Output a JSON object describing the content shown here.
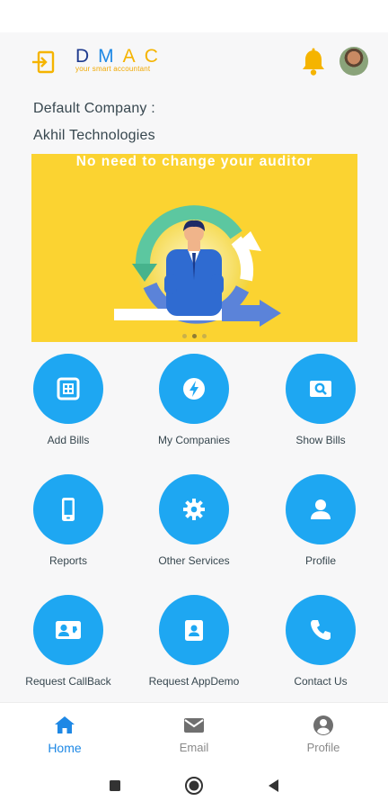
{
  "header": {
    "login_icon": "login-arrow-icon",
    "logo_letters": [
      "D",
      "M",
      "A",
      "C"
    ],
    "logo_tagline": "your smart accountant",
    "bell_icon": "bell-icon",
    "avatar_icon": "user-avatar"
  },
  "company": {
    "label": "Default Company :",
    "name": "Akhil Technologies"
  },
  "banner": {
    "text": "No need to change your auditor",
    "slides": 3,
    "active_slide": 2
  },
  "tiles": [
    {
      "label": "Add Bills",
      "icon": "add-bill-icon"
    },
    {
      "label": "My Companies",
      "icon": "lightning-icon"
    },
    {
      "label": "Show Bills",
      "icon": "search-image-icon"
    },
    {
      "label": "Reports",
      "icon": "phone-device-icon"
    },
    {
      "label": "Other Services",
      "icon": "gear-icon"
    },
    {
      "label": "Profile",
      "icon": "person-icon"
    },
    {
      "label": "Request CallBack",
      "icon": "contact-card-icon"
    },
    {
      "label": "Request AppDemo",
      "icon": "contact-badge-icon"
    },
    {
      "label": "Contact Us",
      "icon": "phone-icon"
    }
  ],
  "bottom_nav": [
    {
      "label": "Home",
      "icon": "home-icon",
      "active": true
    },
    {
      "label": "Email",
      "icon": "mail-icon",
      "active": false
    },
    {
      "label": "Profile",
      "icon": "account-circle-icon",
      "active": false
    }
  ],
  "system_nav": [
    "recents-button",
    "home-button",
    "back-button"
  ],
  "colors": {
    "accent": "#1ea7f2",
    "brand_yellow": "#f5b400",
    "banner_bg": "#fbd331",
    "active_nav": "#1e88e5",
    "text": "#37474f"
  }
}
